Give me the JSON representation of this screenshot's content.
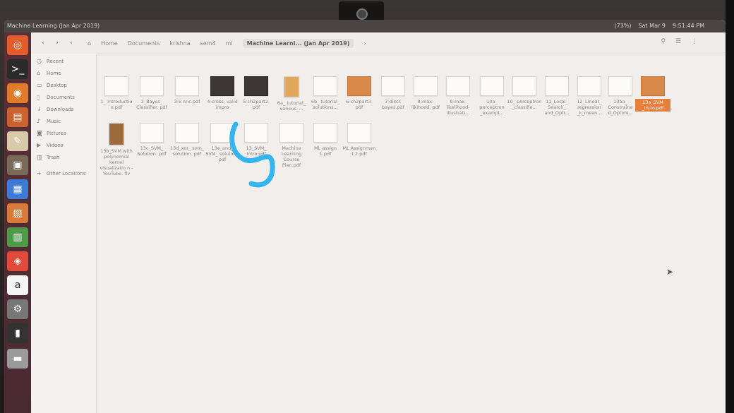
{
  "window": {
    "title": "Machine Learning (Jan Apr 2019)"
  },
  "top_panel": {
    "battery": "(73%)",
    "time": "Sat Mar 9",
    "clock": "9:51:44 PM"
  },
  "breadcrumb": {
    "items": [
      "Home",
      "Documents",
      "krishna",
      "sem4",
      "ml",
      "Machine Learni... (Jan Apr 2019)"
    ]
  },
  "sidebar": {
    "items": [
      {
        "label": "Recent",
        "icon": "clock-icon"
      },
      {
        "label": "Home",
        "icon": "home-icon"
      },
      {
        "label": "Desktop",
        "icon": "desktop-icon"
      },
      {
        "label": "Documents",
        "icon": "documents-icon"
      },
      {
        "label": "Downloads",
        "icon": "download-icon"
      },
      {
        "label": "Music",
        "icon": "music-icon"
      },
      {
        "label": "Pictures",
        "icon": "camera-icon"
      },
      {
        "label": "Videos",
        "icon": "video-icon"
      },
      {
        "label": "Trash",
        "icon": "trash-icon"
      },
      {
        "label": "Other Locations",
        "icon": "plus-icon"
      }
    ]
  },
  "files": {
    "row1": [
      {
        "name": "1_ Introductio n.pdf"
      },
      {
        "name": "2_Bayes_ Classifier. pdf"
      },
      {
        "name": "3-k nnc.pdf"
      },
      {
        "name": "4-cross- valid impro"
      },
      {
        "name": "5-ch2part2. pdf"
      },
      {
        "name": "6a_ tutorial_ various_..."
      },
      {
        "name": "6b_ tutorial_ solutions..."
      },
      {
        "name": "6-ch2part3. pdf"
      },
      {
        "name": "7-discr. bayes.pdf"
      },
      {
        "name": "8-max- likihood. pdf"
      },
      {
        "name": "9-max- likelihood- illustrati..."
      },
      {
        "name": "10a_ perceptron _exampl..."
      },
      {
        "name": "10_ perceptron _classifie..."
      },
      {
        "name": "11_Local_ Search_ and_Opti..."
      },
      {
        "name": "12_Linear_ regression _k_mean..."
      },
      {
        "name": "13aa_ Constraine d_Optimi..."
      },
      {
        "name": "13a_SVM _intro.pdf"
      }
    ],
    "row2": [
      {
        "name": "13b_SVM with polynomial kernel visualizatio n - YouTube. flv"
      },
      {
        "name": "13c_SVM_ Solution. pdf"
      },
      {
        "name": "13d_xor_ svm_ solution. pdf"
      },
      {
        "name": "13e_and_ SVM_ solution. pdf"
      },
      {
        "name": "13_SVM_ Intro.pdf"
      },
      {
        "name": "Machine Learning Course Plan.pdf"
      },
      {
        "name": "ML assign 1.pdf"
      },
      {
        "name": "ML Assignmen t 2.pdf"
      }
    ]
  },
  "colors": {
    "selection": "#e67e3c",
    "launcher": "#5a2f37",
    "scribble": "#33b6f0"
  }
}
